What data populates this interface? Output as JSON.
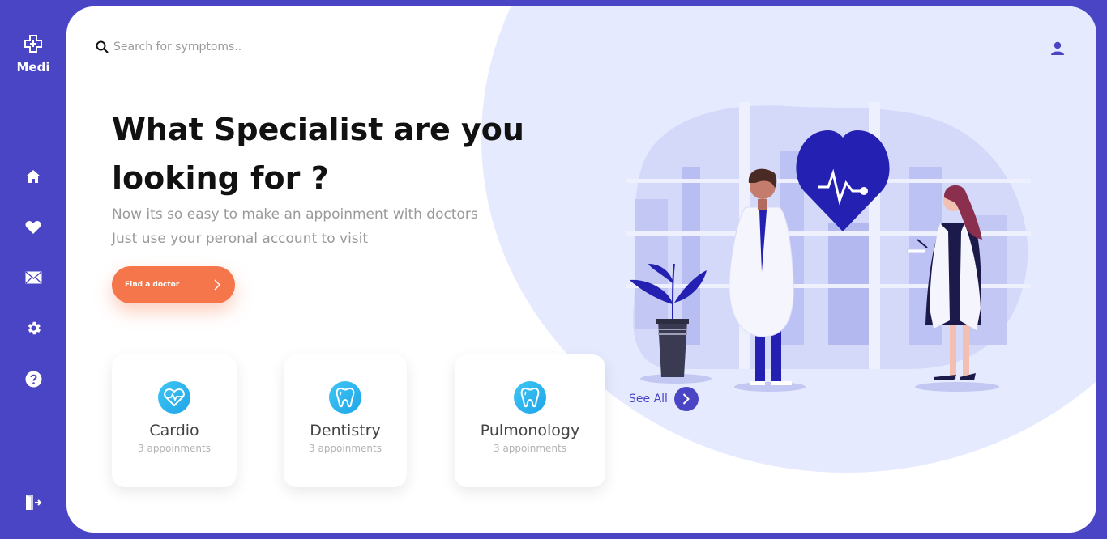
{
  "app": {
    "name": "Medi"
  },
  "sidebar": {
    "items": [
      {
        "name": "home",
        "icon": "home-icon"
      },
      {
        "name": "favorites",
        "icon": "heart-icon"
      },
      {
        "name": "messages",
        "icon": "mail-icon"
      },
      {
        "name": "settings",
        "icon": "gear-icon"
      },
      {
        "name": "help",
        "icon": "help-icon"
      }
    ],
    "logout_icon": "logout-icon"
  },
  "search": {
    "placeholder": "Search for symptoms.."
  },
  "hero": {
    "title_line1": "What Specialist are you",
    "title_line2": "looking for ?",
    "subtitle_line1": "Now its so easy to make an appoinment with doctors",
    "subtitle_line2": "Just use your peronal account to visit",
    "cta_label": "Find a doctor"
  },
  "specialties": [
    {
      "title": "Cardio",
      "count": "3 appoinments",
      "icon": "heart-pulse-icon"
    },
    {
      "title": "Dentistry",
      "count": "3 appoinments",
      "icon": "tooth-icon"
    },
    {
      "title": "Pulmonology",
      "count": "3 appoinments",
      "icon": "tooth-icon"
    }
  ],
  "see_all": {
    "label": "See All"
  },
  "colors": {
    "primary": "#4a45c4",
    "accent": "#f5764a",
    "icon_gradient": "#3fc6f4",
    "blob": "#e5eafe"
  }
}
